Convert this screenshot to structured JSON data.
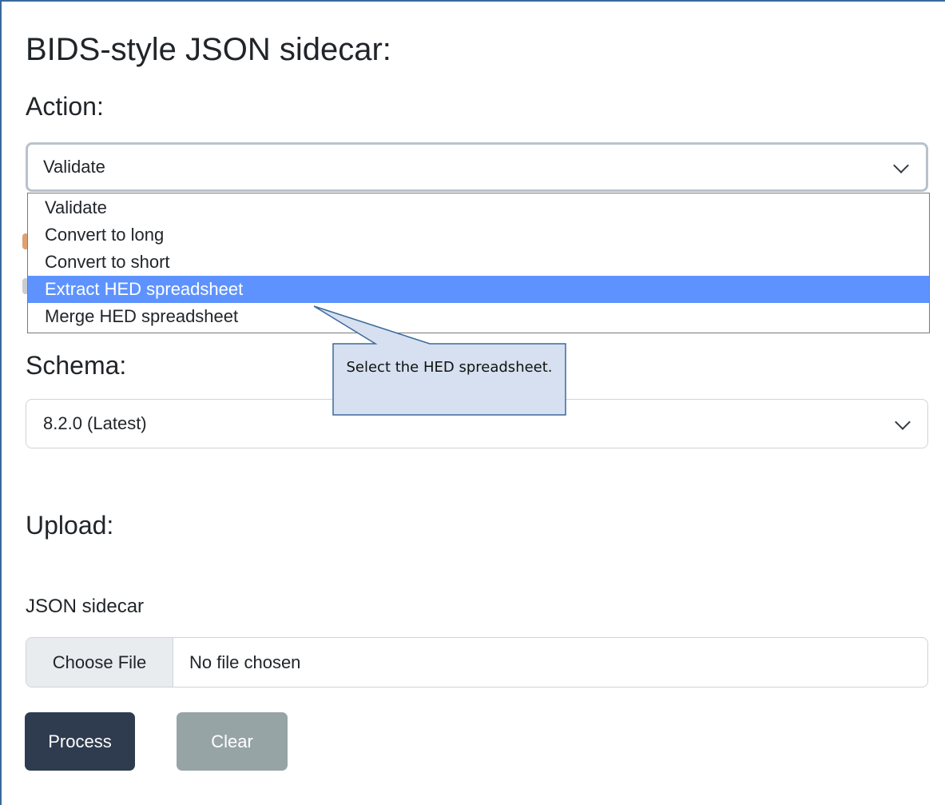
{
  "page": {
    "title": "BIDS-style JSON sidecar:"
  },
  "action": {
    "label": "Action:",
    "selected_value": "Validate",
    "options": [
      "Validate",
      "Convert to long",
      "Convert to short",
      "Extract HED spreadsheet",
      "Merge HED spreadsheet"
    ],
    "highlighted_option": "Extract HED spreadsheet"
  },
  "schema": {
    "label": "Schema:",
    "selected_value": "8.2.0 (Latest)"
  },
  "callout": {
    "text": "Select the HED spreadsheet."
  },
  "upload": {
    "label": "Upload:",
    "field_label": "JSON sidecar",
    "choose_button": "Choose File",
    "status": "No file chosen"
  },
  "buttons": {
    "process": "Process",
    "clear": "Clear"
  },
  "colors": {
    "highlight": "#5e93ff",
    "process_button": "#2f3c4f",
    "clear_button": "#97a4a5",
    "callout_fill": "#d6e0f0",
    "callout_border": "#3b6a9a",
    "frame_border": "#3b6a9a"
  }
}
